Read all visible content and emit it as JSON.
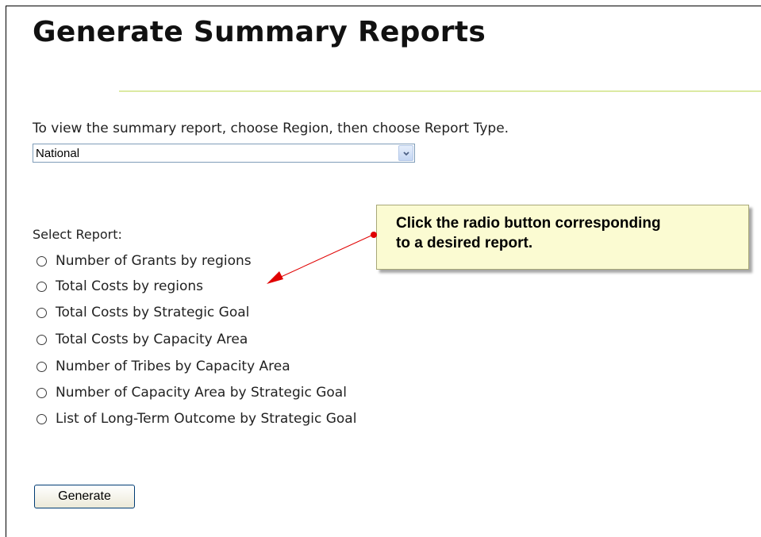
{
  "page": {
    "title": "Generate Summary Reports",
    "instruction": "To view the summary report, choose Region, then choose Report Type."
  },
  "region_select": {
    "selected": "National"
  },
  "report": {
    "label": "Select Report:",
    "options": [
      "Number of Grants by regions",
      "Total Costs by regions",
      "Total Costs by Strategic Goal",
      "Total Costs by Capacity Area",
      "Number of Tribes by Capacity Area",
      "Number of Capacity Area by Strategic Goal",
      "List of Long-Term Outcome by Strategic Goal"
    ]
  },
  "callout": {
    "line1": "Click the radio button corresponding",
    "line2": "to a desired report."
  },
  "actions": {
    "generate_label": "Generate"
  },
  "colors": {
    "rule": "#dceaa3",
    "callout_bg": "#fbfbd2",
    "arrow": "#e00000"
  }
}
